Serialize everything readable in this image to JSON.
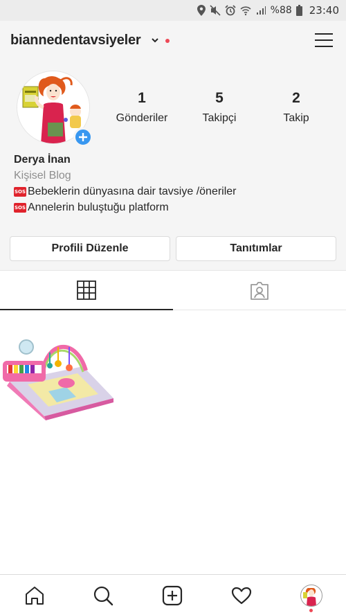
{
  "status_bar": {
    "battery": "%88",
    "time": "23:40",
    "icons": [
      "location-icon",
      "mute-icon",
      "alarm-icon",
      "wifi-icon",
      "signal-icon",
      "battery-icon"
    ]
  },
  "header": {
    "username": "biannedentavsiyeler",
    "icons": [
      "chevron-down-icon",
      "menu-icon"
    ],
    "notification_color": "#ed4956"
  },
  "profile": {
    "stats": [
      {
        "value": "1",
        "label": "Gönderiler"
      },
      {
        "value": "5",
        "label": "Takipçi"
      },
      {
        "value": "2",
        "label": "Takip"
      }
    ],
    "full_name": "Derya İnan",
    "category": "Kişisel Blog",
    "bio": [
      {
        "badge": "SOS",
        "text": "Bebeklerin dünyasına dair tavsiye /öneriler"
      },
      {
        "badge": "SOS",
        "text": "Annelerin buluştuğu platform"
      }
    ],
    "add_story_color": "#3897f0"
  },
  "actions": {
    "edit_profile": "Profili Düzenle",
    "promotions": "Tanıtımlar"
  },
  "tabs": [
    {
      "name": "grid-icon",
      "active": true
    },
    {
      "name": "tagged-icon",
      "active": false
    }
  ],
  "bottom_nav": [
    "home-icon",
    "search-icon",
    "add-icon",
    "heart-icon",
    "profile-avatar"
  ]
}
